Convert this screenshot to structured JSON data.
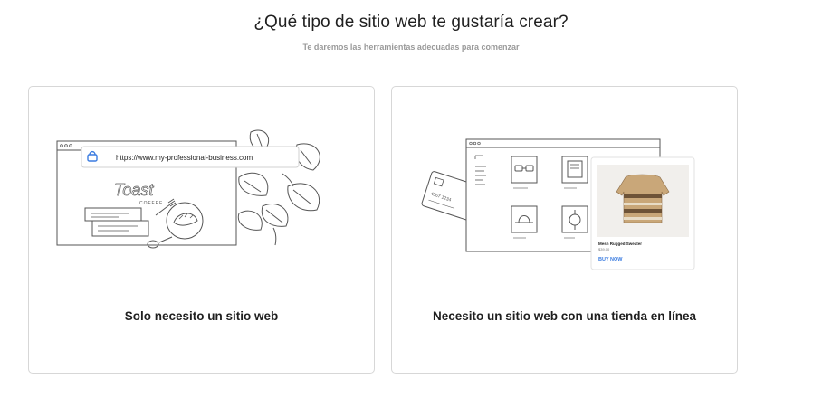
{
  "header": {
    "title": "¿Qué tipo de sitio web te gustaría crear?",
    "subtitle": "Te daremos las herramientas adecuadas para comenzar"
  },
  "options": [
    {
      "label": "Solo necesito un sitio web",
      "illustration": {
        "url": "https://www.my-professional-business.com",
        "logo_script": "Toast",
        "logo_sub": "COFFEE"
      }
    },
    {
      "label": "Necesito un sitio web con una tienda en línea",
      "illustration": {
        "product_name": "Mesh Rugged Sweater",
        "product_price": "$39.00",
        "buy_label": "BUY NOW",
        "card_number": "4567 1234"
      }
    }
  ],
  "colors": {
    "accent": "#3b7ce0",
    "border": "#d7d7d7",
    "subtitle": "#9a9a9a"
  }
}
